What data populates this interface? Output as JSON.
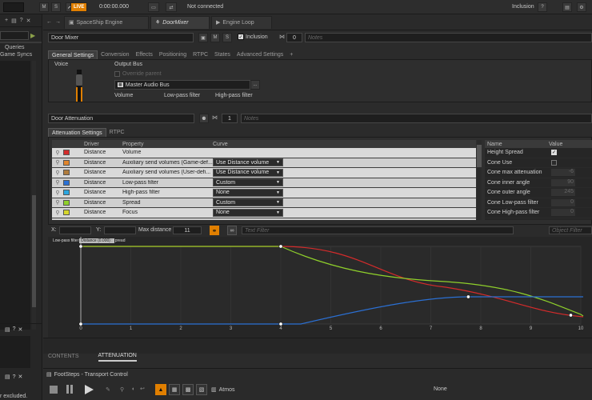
{
  "topbar": {
    "btn_m": "M",
    "btn_s": "S",
    "live": "LIVE",
    "time": "0:00:00.000",
    "status": "Not connected",
    "inclusion": "Inclusion",
    "help": "?"
  },
  "left": {
    "items": [
      "Queries",
      "Game Syncs"
    ],
    "footer": "r excluded."
  },
  "tabs": [
    {
      "label": "SpaceShip Engine"
    },
    {
      "label": "DoorMixer"
    },
    {
      "label": "Engine Loop"
    }
  ],
  "header": {
    "name": "Door Mixer",
    "btn_m": "M",
    "btn_s": "S",
    "inclusion_label": "Inclusion",
    "count": "0",
    "notes_placeholder": "Notes"
  },
  "subtabs": [
    "General Settings",
    "Conversion",
    "Effects",
    "Positioning",
    "RTPC",
    "States",
    "Advanced Settings",
    "+"
  ],
  "general": {
    "voice_label": "Voice",
    "output_bus_label": "Output Bus",
    "override_parent": "Override parent",
    "bus_value": "Master Audio Bus",
    "browse": "...",
    "volume": "Volume",
    "lpf": "Low-pass filter",
    "hpf": "High-pass filter"
  },
  "attenuation": {
    "name": "Door Attenuation",
    "count": "1",
    "notes_placeholder": "Notes",
    "tabs": [
      "Attenuation Settings",
      "RTPC"
    ],
    "columns": [
      "Driver",
      "Property",
      "Curve"
    ],
    "rows": [
      {
        "color": "#d42b2b",
        "driver": "Distance",
        "property": "Volume",
        "curve": ""
      },
      {
        "color": "#e0852b",
        "driver": "Distance",
        "property": "Auxiliary send volumes (Game-def...",
        "curve": "Use Distance volume"
      },
      {
        "color": "#b07c3c",
        "driver": "Distance",
        "property": "Auxiliary send volumes (User-defi...",
        "curve": "Use Distance volume"
      },
      {
        "color": "#2b70d4",
        "driver": "Distance",
        "property": "Low-pass filter",
        "curve": "Custom"
      },
      {
        "color": "#2ba6e0",
        "driver": "Distance",
        "property": "High-pass filter",
        "curve": "None"
      },
      {
        "color": "#8fd02b",
        "driver": "Distance",
        "property": "Spread",
        "curve": "Custom"
      },
      {
        "color": "#d6d62b",
        "driver": "Distance",
        "property": "Focus",
        "curve": "None"
      }
    ],
    "props_columns": [
      "Name",
      "Value"
    ],
    "props": [
      {
        "name": "Height Spread",
        "value": "",
        "check": "on"
      },
      {
        "name": "Cone Use",
        "value": "",
        "check": "off"
      },
      {
        "name": "Cone max attenuation",
        "value": "-6"
      },
      {
        "name": "Cone inner angle",
        "value": "90"
      },
      {
        "name": "Cone outer angle",
        "value": "245"
      },
      {
        "name": "Cone Low-pass filter",
        "value": "0"
      },
      {
        "name": "Cone High-pass filter",
        "value": "0"
      }
    ]
  },
  "graph_toolbar": {
    "x_label": "X:",
    "y_label": "Y:",
    "max_distance_label": "Max distance",
    "max_distance": "11",
    "text_filter": "Text Filter",
    "object_filter": "Object Filter"
  },
  "graph": {
    "legend_left": "Low-pass filter",
    "legend_tooltip": "Distance (0.000) :",
    "legend_right": "pread",
    "x_ticks": [
      "0",
      "1",
      "2",
      "3",
      "4",
      "5",
      "6",
      "7",
      "8",
      "9",
      "10"
    ],
    "colors": {
      "volume": "#d42b2b",
      "spread": "#8fd02b",
      "lpf": "#2b70d4"
    }
  },
  "bottom_tabs": [
    "CONTENTS",
    "ATTENUATION"
  ],
  "transport": {
    "title": "FootSteps - Transport Control",
    "atmos": "Atmos",
    "none": "None"
  }
}
